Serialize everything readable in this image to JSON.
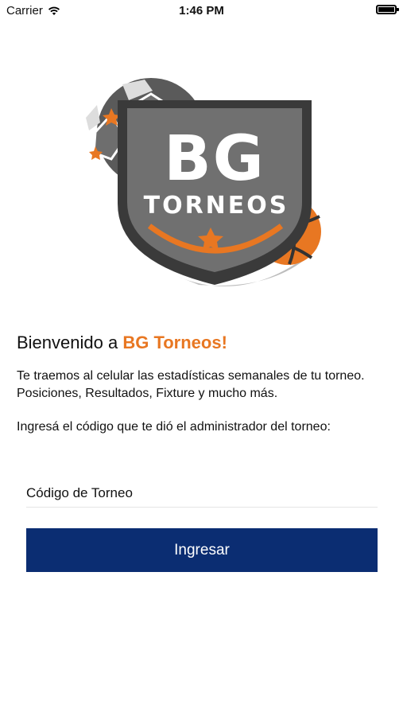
{
  "status_bar": {
    "carrier": "Carrier",
    "time": "1:46 PM"
  },
  "logo": {
    "line1": "BG",
    "line2": "TORNEOS",
    "colors": {
      "accent": "#e87722",
      "shield": "#6b6b6b",
      "dark": "#3a3a3a"
    }
  },
  "welcome": {
    "prefix": "Bienvenido a ",
    "brand": "BG Torneos!",
    "intro": "Te traemos al celular las estadísticas semanales de tu torneo. Posiciones, Resultados, Fixture y mucho más.",
    "prompt": "Ingresá el código que te dió el administrador del torneo:"
  },
  "form": {
    "code_placeholder": "Código de Torneo",
    "code_value": "",
    "submit_label": "Ingresar"
  },
  "colors": {
    "brand_orange": "#e87722",
    "button_blue": "#0b2d72"
  }
}
